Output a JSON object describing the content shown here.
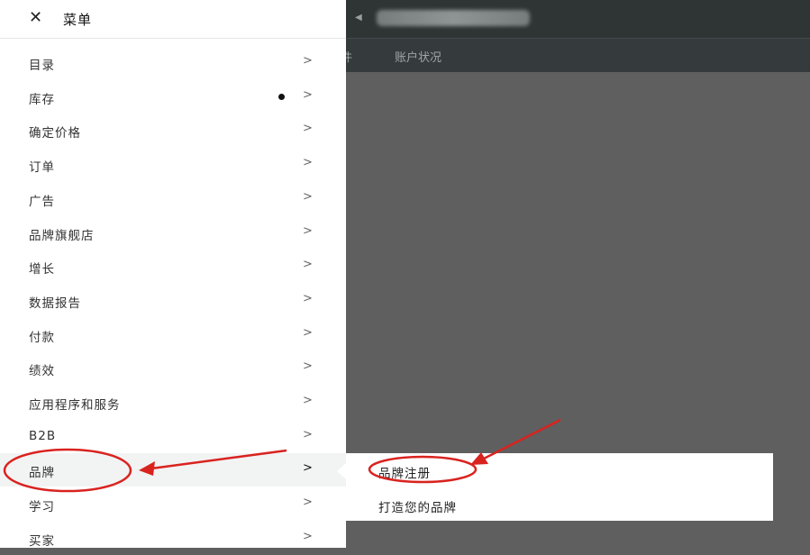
{
  "header": {
    "title": "菜单"
  },
  "app": {
    "nav_tabs": [
      "件",
      "账户状况"
    ]
  },
  "menu_items": [
    {
      "label": "目录",
      "chevron": ">"
    },
    {
      "label": "库存",
      "chevron": ">",
      "has_dot": true
    },
    {
      "label": "确定价格",
      "chevron": ">"
    },
    {
      "label": "订单",
      "chevron": ">"
    },
    {
      "label": "广告",
      "chevron": ">"
    },
    {
      "label": "品牌旗舰店",
      "chevron": ">"
    },
    {
      "label": "增长",
      "chevron": ">"
    },
    {
      "label": "数据报告",
      "chevron": ">"
    },
    {
      "label": "付款",
      "chevron": ">"
    },
    {
      "label": "绩效",
      "chevron": ">"
    },
    {
      "label": "应用程序和服务",
      "chevron": ">"
    },
    {
      "label": "B2B",
      "chevron": ">"
    },
    {
      "label": "品牌",
      "chevron": ">",
      "active": true
    },
    {
      "label": "学习",
      "chevron": ">"
    },
    {
      "label": "买家",
      "chevron": ">"
    }
  ],
  "submenu": {
    "items": [
      "品牌注册",
      "打造您的品牌"
    ]
  },
  "colors": {
    "annotation": "#d9231f",
    "topbar": "#2f3435",
    "overlay": "#5f5f5f"
  }
}
